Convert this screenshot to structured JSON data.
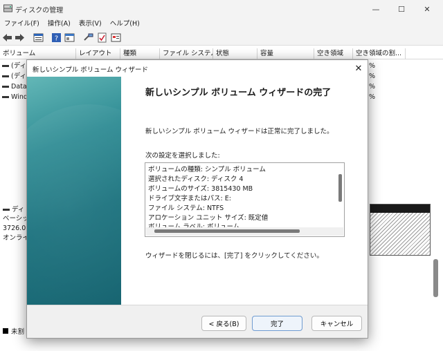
{
  "window": {
    "title": "ディスクの管理",
    "controls": {
      "minimize": "—",
      "maximize": "☐",
      "close": "✕"
    }
  },
  "menu": [
    "ファイル(F)",
    "操作(A)",
    "表示(V)",
    "ヘルプ(H)"
  ],
  "toolbar_icons": [
    "back-arrow-icon",
    "forward-arrow-icon",
    "properties-icon",
    "help-icon",
    "console-icon",
    "connect-icon",
    "check-icon",
    "panel-icon"
  ],
  "columns": [
    "ボリューム",
    "レイアウト",
    "種類",
    "ファイル システム",
    "状態",
    "容量",
    "空き領域",
    "空き領域の割..."
  ],
  "volumes": [
    {
      "name": "(ディ",
      "pct": "%"
    },
    {
      "name": "(ディ",
      "pct": "%"
    },
    {
      "name": "Data",
      "pct": "%"
    },
    {
      "name": "Wind",
      "pct": "%"
    }
  ],
  "disk_panel": {
    "name": "ディ",
    "lines": [
      "ベーシッ",
      "3726.0",
      "オンライ"
    ]
  },
  "legend": {
    "label": "未割"
  },
  "wizard": {
    "title": "新しいシンプル ボリューム ウィザード",
    "close": "✕",
    "heading": "新しいシンプル ボリューム ウィザードの完了",
    "completed_text": "新しいシンプル ボリューム ウィザードは正常に完了しました。",
    "selected_label": "次の設定を選択しました:",
    "settings": [
      "ボリュームの種類: シンプル ボリューム",
      "選択されたディスク: ディスク 4",
      "ボリュームのサイズ: 3815430 MB",
      "ドライブ文字またはパス: E:",
      "ファイル システム: NTFS",
      "アロケーション ユニット サイズ: 既定値",
      "ボリューム ラベル: ボリューム"
    ],
    "close_instruction": "ウィザードを閉じるには、[完了] をクリックしてください。",
    "buttons": {
      "back": "< 戻る(B)",
      "finish": "完了",
      "cancel": "キャンセル"
    }
  }
}
